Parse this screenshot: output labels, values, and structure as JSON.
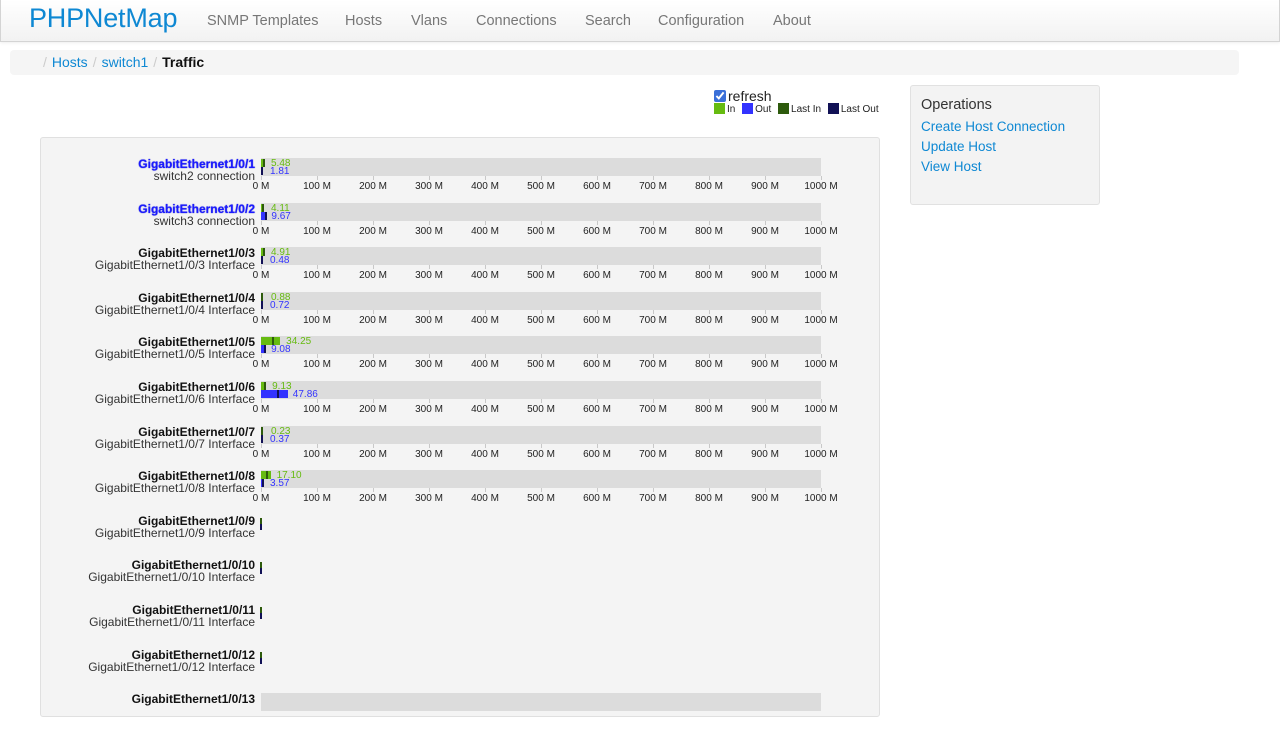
{
  "navbar": {
    "brand": "PHPNetMap",
    "items": [
      "SNMP Templates",
      "Hosts",
      "Vlans",
      "Connections",
      "Search",
      "Configuration",
      "About"
    ]
  },
  "breadcrumb": {
    "items": [
      {
        "label": "Hosts",
        "link": true
      },
      {
        "label": "switch1",
        "link": true
      },
      {
        "label": "Traffic",
        "link": false
      }
    ]
  },
  "refresh": {
    "label": "refresh",
    "checked": true
  },
  "legend": [
    {
      "label": "In",
      "color": "#66bb11"
    },
    {
      "label": "Out",
      "color": "#3333ff"
    },
    {
      "label": "Last In",
      "color": "#2d5a0c"
    },
    {
      "label": "Last Out",
      "color": "#111155"
    }
  ],
  "operations": {
    "title": "Operations",
    "links": [
      "Create Host Connection",
      "Update Host",
      "View Host"
    ]
  },
  "chart_data": {
    "type": "bar",
    "title": "Traffic",
    "unit": "Mbps",
    "xlim": [
      0,
      1000
    ],
    "ticks": [
      "0 M",
      "100 M",
      "200 M",
      "300 M",
      "400 M",
      "500 M",
      "600 M",
      "700 M",
      "800 M",
      "900 M",
      "1000 M"
    ],
    "colors": {
      "in": "#66bb11",
      "out": "#3333ff",
      "last_in": "#2d5a0c",
      "last_out": "#111155"
    },
    "interfaces": [
      {
        "name": "GigabitEthernet1/0/1",
        "description": "switch2 connection",
        "linked": true,
        "in": 5.48,
        "out": 1.81,
        "last_in": 5.0,
        "last_out": 1.8,
        "has_bar": true
      },
      {
        "name": "GigabitEthernet1/0/2",
        "description": "switch3 connection",
        "linked": true,
        "in": 4.11,
        "out": 9.67,
        "last_in": 4.0,
        "last_out": 9.5,
        "has_bar": true
      },
      {
        "name": "GigabitEthernet1/0/3",
        "description": "GigabitEthernet1/0/3 Interface",
        "linked": false,
        "in": 4.91,
        "out": 0.48,
        "last_in": 4.5,
        "last_out": 0.5,
        "has_bar": true
      },
      {
        "name": "GigabitEthernet1/0/4",
        "description": "GigabitEthernet1/0/4 Interface",
        "linked": false,
        "in": 0.88,
        "out": 0.72,
        "last_in": 0.8,
        "last_out": 0.7,
        "has_bar": true
      },
      {
        "name": "GigabitEthernet1/0/5",
        "description": "GigabitEthernet1/0/5 Interface",
        "linked": false,
        "in": 34.25,
        "out": 9.08,
        "last_in": 22.0,
        "last_out": 8.0,
        "has_bar": true
      },
      {
        "name": "GigabitEthernet1/0/6",
        "description": "GigabitEthernet1/0/6 Interface",
        "linked": false,
        "in": 9.13,
        "out": 47.86,
        "last_in": 8.0,
        "last_out": 31.0,
        "has_bar": true
      },
      {
        "name": "GigabitEthernet1/0/7",
        "description": "GigabitEthernet1/0/7 Interface",
        "linked": false,
        "in": 0.23,
        "out": 0.37,
        "last_in": 0.2,
        "last_out": 0.3,
        "has_bar": true
      },
      {
        "name": "GigabitEthernet1/0/8",
        "description": "GigabitEthernet1/0/8 Interface",
        "linked": false,
        "in": 17.1,
        "out": 3.57,
        "last_in": 10.0,
        "last_out": 3.0,
        "has_bar": true
      },
      {
        "name": "GigabitEthernet1/0/9",
        "description": "GigabitEthernet1/0/9 Interface",
        "linked": false,
        "has_bar": false
      },
      {
        "name": "GigabitEthernet1/0/10",
        "description": "GigabitEthernet1/0/10 Interface",
        "linked": false,
        "has_bar": false
      },
      {
        "name": "GigabitEthernet1/0/11",
        "description": "GigabitEthernet1/0/11 Interface",
        "linked": false,
        "has_bar": false
      },
      {
        "name": "GigabitEthernet1/0/12",
        "description": "GigabitEthernet1/0/12 Interface",
        "linked": false,
        "has_bar": false
      },
      {
        "name": "GigabitEthernet1/0/13",
        "description": "",
        "linked": false,
        "has_bar": true,
        "partial": true
      }
    ]
  }
}
